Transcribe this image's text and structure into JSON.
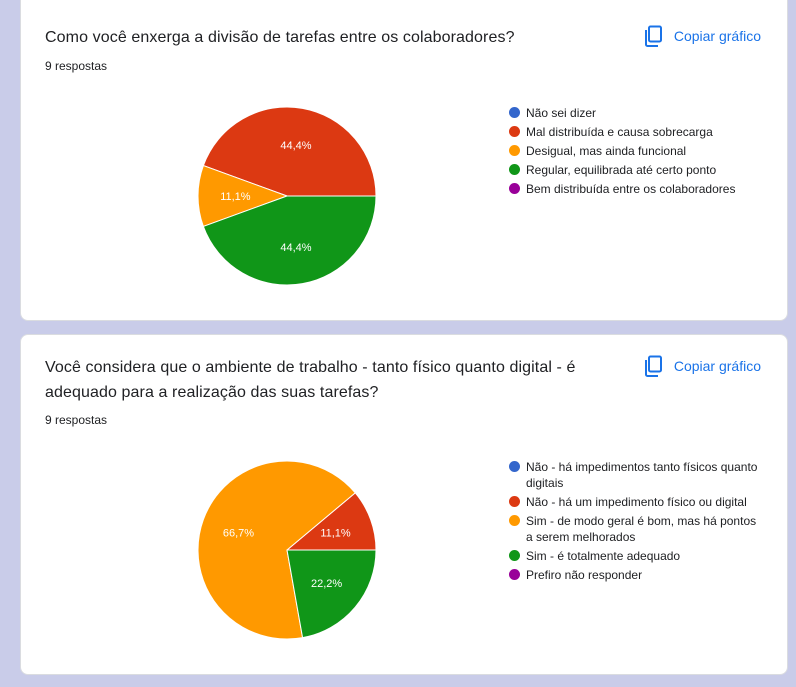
{
  "charts": [
    {
      "question": "Como você enxerga a divisão de tarefas entre os colaboradores?",
      "responses": "9 respostas",
      "copy_label": "Copiar gráfico",
      "icon": "copy-icon"
    },
    {
      "question": "Você considera que o ambiente de trabalho - tanto físico quanto digital - é adequado para a realização das suas tarefas?",
      "responses": "9 respostas",
      "copy_label": "Copiar gráfico",
      "icon": "copy-icon"
    }
  ],
  "chart_data": [
    {
      "type": "pie",
      "title": "Como você enxerga a divisão de tarefas entre os colaboradores?",
      "categories": [
        "Não sei dizer",
        "Mal distribuída e causa sobrecarga",
        "Desigual, mas ainda funcional",
        "Regular, equilibrada até certo ponto",
        "Bem distribuída entre os colaboradores"
      ],
      "values": [
        0,
        44.4,
        11.1,
        44.4,
        0
      ],
      "labels": [
        "",
        "44,4%",
        "11,1%",
        "44,4%",
        ""
      ],
      "colors": [
        "#3366cc",
        "#dc3912",
        "#ff9900",
        "#109618",
        "#990099"
      ],
      "legend": "right"
    },
    {
      "type": "pie",
      "title": "Você considera que o ambiente de trabalho - tanto físico quanto digital - é adequado para a realização das suas tarefas?",
      "categories": [
        "Não - há impedimentos tanto físicos quanto digitais",
        "Não - há um impedimento físico ou digital",
        "Sim - de modo geral é bom, mas há pontos a serem melhorados",
        "Sim - é totalmente adequado",
        "Prefiro não responder"
      ],
      "values": [
        0,
        11.1,
        66.7,
        22.2,
        0
      ],
      "labels": [
        "",
        "11,1%",
        "66,7%",
        "22,2%",
        ""
      ],
      "colors": [
        "#3366cc",
        "#dc3912",
        "#ff9900",
        "#109618",
        "#990099"
      ],
      "legend": "right"
    }
  ]
}
